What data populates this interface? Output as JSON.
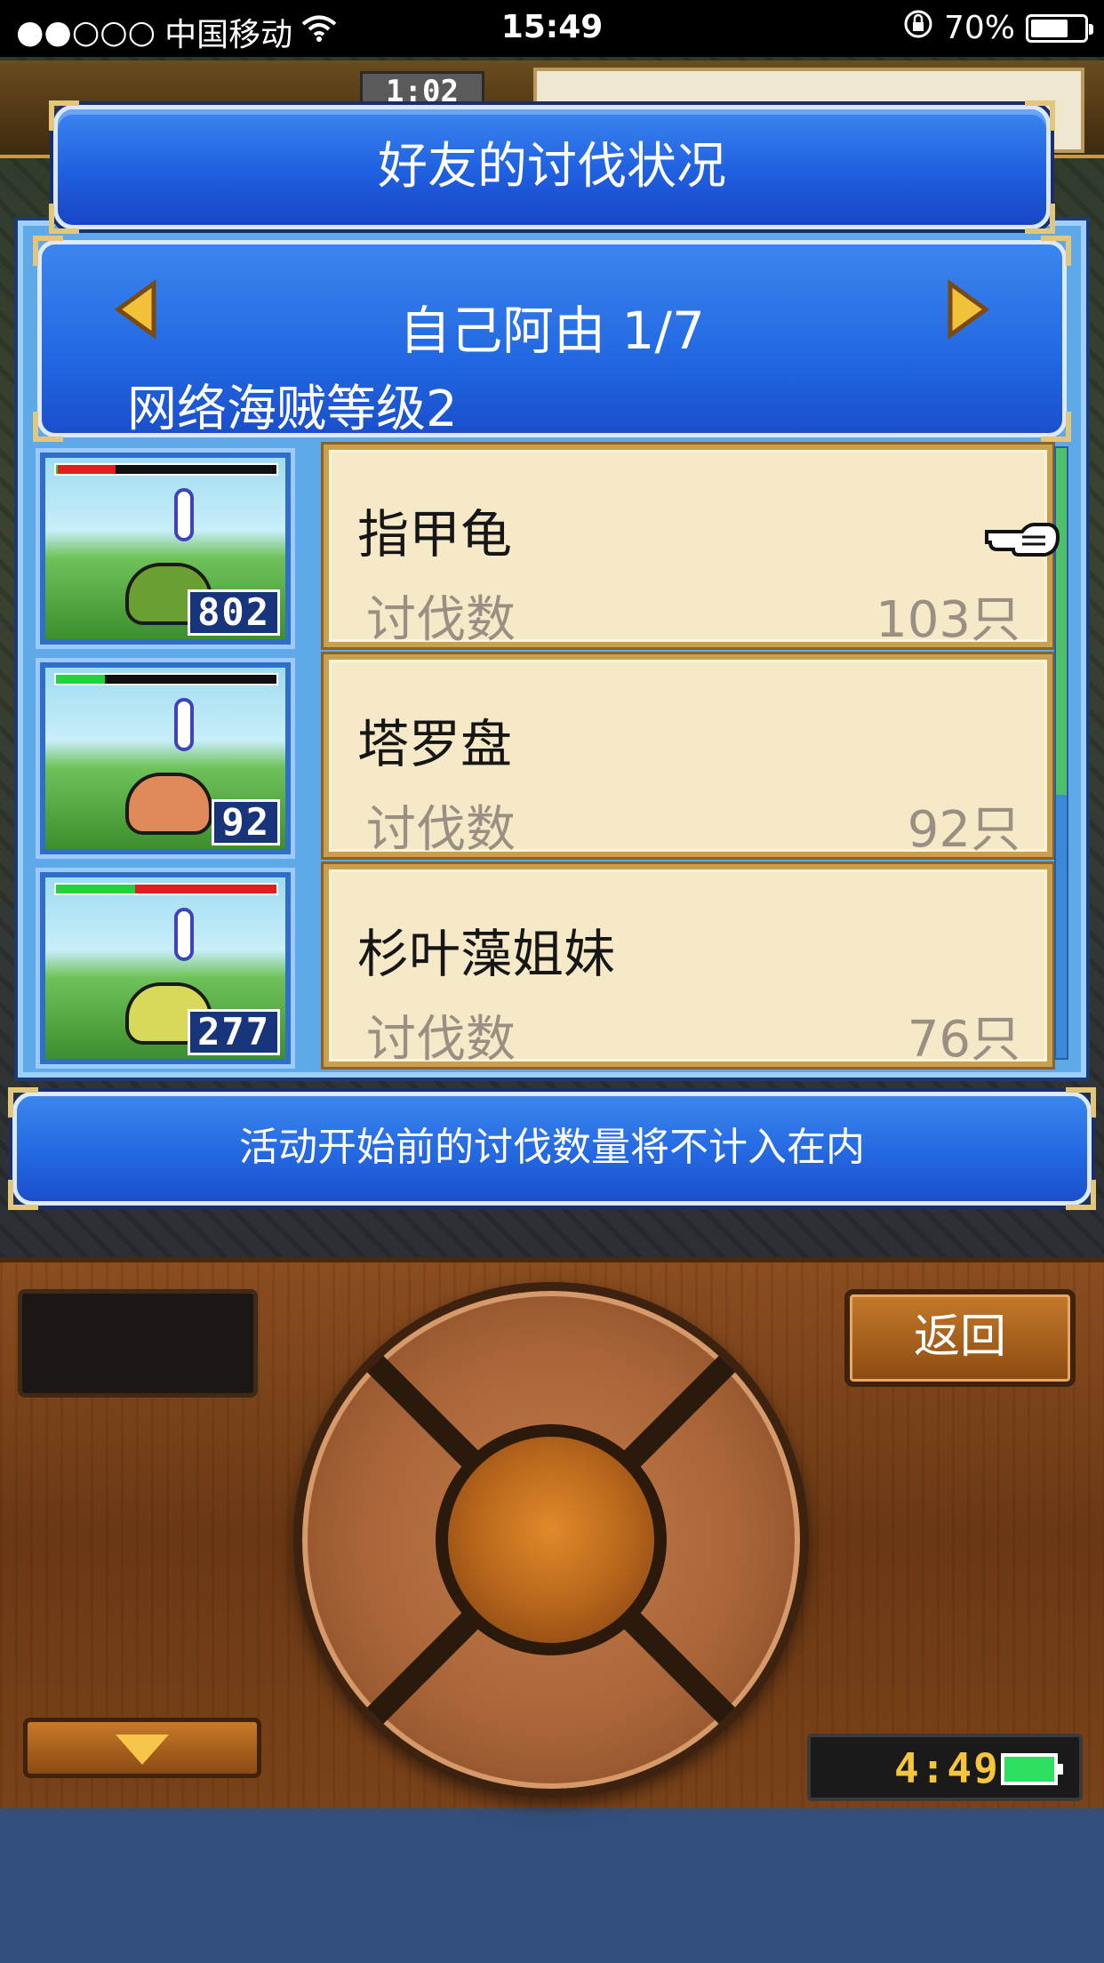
{
  "status_bar": {
    "signal_dots": "●●○○○",
    "carrier": "中国移动",
    "time": "15:49",
    "battery_percent": "70%",
    "battery_level": 0.7,
    "icons": [
      "signal-icon",
      "wifi-icon",
      "rotation-lock-icon",
      "battery-icon"
    ]
  },
  "hud": {
    "timer": "1:02"
  },
  "dialog": {
    "title": "好友的讨伐状况",
    "player_name": "自己阿由 1/7",
    "player_rank": "网络海贼等级2",
    "monsters": [
      {
        "name": "指甲龟",
        "label": "讨伐数",
        "count_text": "103只",
        "thumb_count": "802",
        "hp_green": 0.01,
        "hp_red": 0.26,
        "creature_color": "#6aa032"
      },
      {
        "name": "塔罗盘",
        "label": "讨伐数",
        "count_text": "92只",
        "thumb_count": "92",
        "hp_green": 0.22,
        "hp_red": 0,
        "creature_color": "#e08a5a"
      },
      {
        "name": "杉叶藻姐妹",
        "label": "讨伐数",
        "count_text": "76只",
        "thumb_count": "277",
        "hp_green": 0.36,
        "hp_red": 0.64,
        "creature_color": "#d7d95a"
      }
    ],
    "notice": "活动开始前的讨伐数量将不计入在内"
  },
  "controller": {
    "back_label": "返回",
    "clock": "4:49"
  },
  "colors": {
    "dialog_blue": "#2268e2",
    "card_bg": "#f6e9c8",
    "gold_border": "#c9a052"
  }
}
